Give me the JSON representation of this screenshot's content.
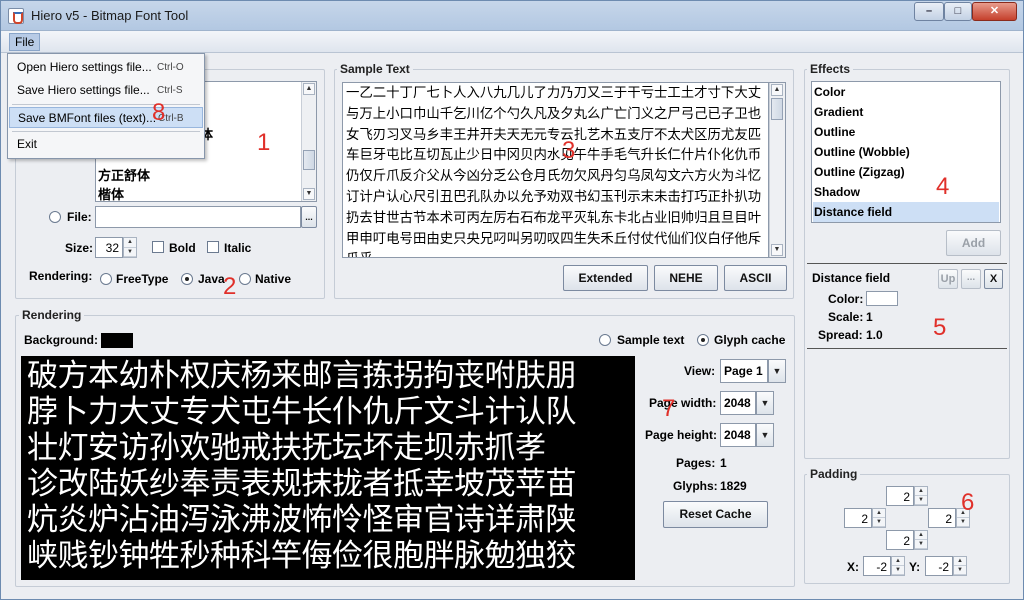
{
  "window": {
    "title": "Hiero v5 - Bitmap Font Tool"
  },
  "menubar": {
    "file": "File"
  },
  "file_menu": {
    "items": [
      {
        "label": "Open Hiero settings file...",
        "shortcut": "Ctrl-O"
      },
      {
        "label": "Save Hiero settings file...",
        "shortcut": "Ctrl-S"
      },
      {
        "label": "Save BMFont files (text)...",
        "shortcut": "Ctrl-B"
      },
      {
        "label": "Exit",
        "shortcut": ""
      }
    ]
  },
  "font_panel": {
    "system_fonts_visible": [
      "方正舒体",
      "楷体"
    ],
    "partial_font": "体",
    "file_label": "File:",
    "size_label": "Size:",
    "size_value": "32",
    "bold_label": "Bold",
    "italic_label": "Italic",
    "rendering_label": "Rendering:",
    "rendering_options": [
      "FreeType",
      "Java",
      "Native"
    ],
    "rendering_selected": "Java"
  },
  "sample_text": {
    "title": "Sample Text",
    "text": "一乙二十丁厂七卜人入八九几儿了力乃刀又三于干亏士工土才寸下大丈与万上小口巾山千乞川亿个勺久凡及夕丸么广亡门义之尸弓己已子卫也女飞刃习叉马乡丰王井开夫天无元专云扎艺木五支厅不太犬区历尤友匹车巨牙屯比互切瓦止少日中冈贝内水见午牛手毛气升长仁什片仆化仇币仍仅斤爪反介父从今凶分乏公仓月氏勿欠风丹匀乌凤勾文六方火为斗忆订计户认心尺引丑巴孔队办以允予劝双书幻玉刊示末未击打巧正扑扒功扔去甘世古节本术可丙左厉右石布龙平灭轧东卡北占业旧帅归且旦目叶甲申叮电号田由史只央兄叼叫另叨叹四生失禾丘付仗代仙们仪白仔他斥瓜乎",
    "buttons": [
      "Extended",
      "NEHE",
      "ASCII"
    ]
  },
  "effects": {
    "title": "Effects",
    "items": [
      "Color",
      "Gradient",
      "Outline",
      "Outline (Wobble)",
      "Outline (Zigzag)",
      "Shadow",
      "Distance field"
    ],
    "selected": "Distance field",
    "add_button": "Add",
    "detail": {
      "name": "Distance field",
      "up_button": "Up",
      "more_button": "...",
      "remove_button": "X",
      "color_label": "Color:",
      "color_value": "#ffffff",
      "scale_label": "Scale:",
      "scale_value": "1",
      "spread_label": "Spread:",
      "spread_value": "1.0"
    }
  },
  "rendering": {
    "title": "Rendering",
    "background_label": "Background:",
    "background_color": "#000000",
    "mode_options": [
      "Sample text",
      "Glyph cache"
    ],
    "mode_selected": "Glyph cache",
    "glyph_lines": [
      "破方本幼朴权庆杨来邮言拣拐拘丧咐肤朋",
      "脖卜力大丈专犬屯牛长仆仇斤文斗计认队",
      "壮灯安访孙欢驰戒扶抚坛坏走坝赤抓孝",
      "诊改陆妖纱奉责表规抹拢者抵幸坡茂苹苗",
      "炕炎炉沾油泻泳沸波怖怜怪审官诗详肃陕",
      "峡贱钞钟牲秒种科竿侮俭很胞胖脉勉独狡"
    ],
    "view_label": "View:",
    "view_value": "Page 1",
    "page_width_label": "Page width:",
    "page_width_value": "2048",
    "page_height_label": "Page height:",
    "page_height_value": "2048",
    "pages_label": "Pages:",
    "pages_value": "1",
    "glyphs_label": "Glyphs:",
    "glyphs_value": "1829",
    "reset_button": "Reset Cache"
  },
  "padding": {
    "title": "Padding",
    "top": "2",
    "left": "2",
    "right": "2",
    "bottom": "2",
    "x_label": "X:",
    "x_value": "-2",
    "y_label": "Y:",
    "y_value": "-2"
  },
  "annotations": [
    "1",
    "2",
    "3",
    "4",
    "5",
    "6",
    "7",
    "8"
  ],
  "colors": {
    "annotation": "#e0302a",
    "selection": "#cddff5"
  }
}
